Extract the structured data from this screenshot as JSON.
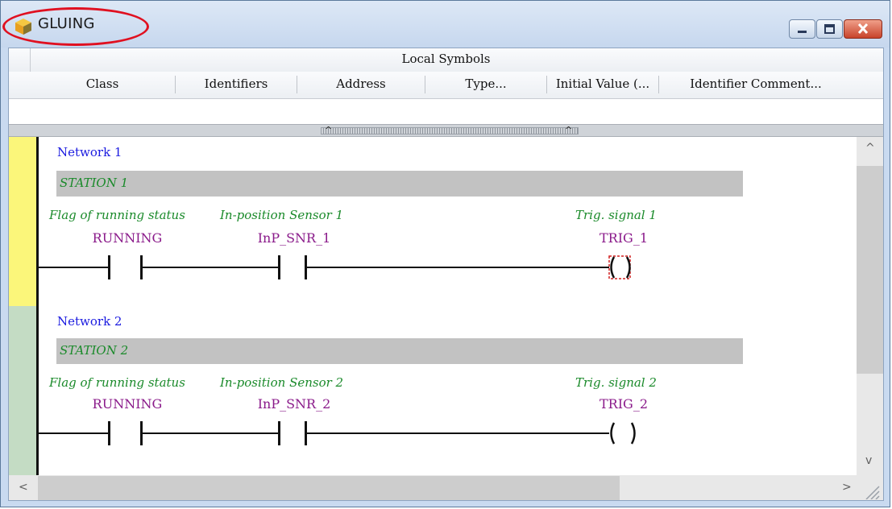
{
  "window": {
    "title": "GLUING",
    "icon": "cube-icon",
    "controls": [
      "minimize-icon",
      "maximize-icon",
      "close-icon"
    ]
  },
  "symbols": {
    "title": "Local Symbols",
    "columns": [
      "Class",
      "Identifiers",
      "Address",
      "Type...",
      "Initial Value (...",
      "Identifier Comment..."
    ]
  },
  "networks": [
    {
      "label": "Network 1",
      "station": "STATION 1",
      "contact1": {
        "comment": "Flag of running status",
        "name": "RUNNING"
      },
      "contact2": {
        "comment": "In-position Sensor 1",
        "name": "InP_SNR_1"
      },
      "coil": {
        "comment": "Trig. signal 1",
        "name": "TRIG_1",
        "selected": true
      }
    },
    {
      "label": "Network 2",
      "station": "STATION 2",
      "contact1": {
        "comment": "Flag of running status",
        "name": "RUNNING"
      },
      "contact2": {
        "comment": "In-position Sensor 2",
        "name": "InP_SNR_2"
      },
      "coil": {
        "comment": "Trig. signal 2",
        "name": "TRIG_2",
        "selected": false
      }
    }
  ],
  "colors": {
    "network1_gutter": "#fbf67a",
    "network2_gutter": "#c4dcc4",
    "comment_text": "#1a8a2a",
    "variable_text": "#8a1a8a",
    "network_label": "#1a1ae0",
    "annotation": "#e01020"
  }
}
